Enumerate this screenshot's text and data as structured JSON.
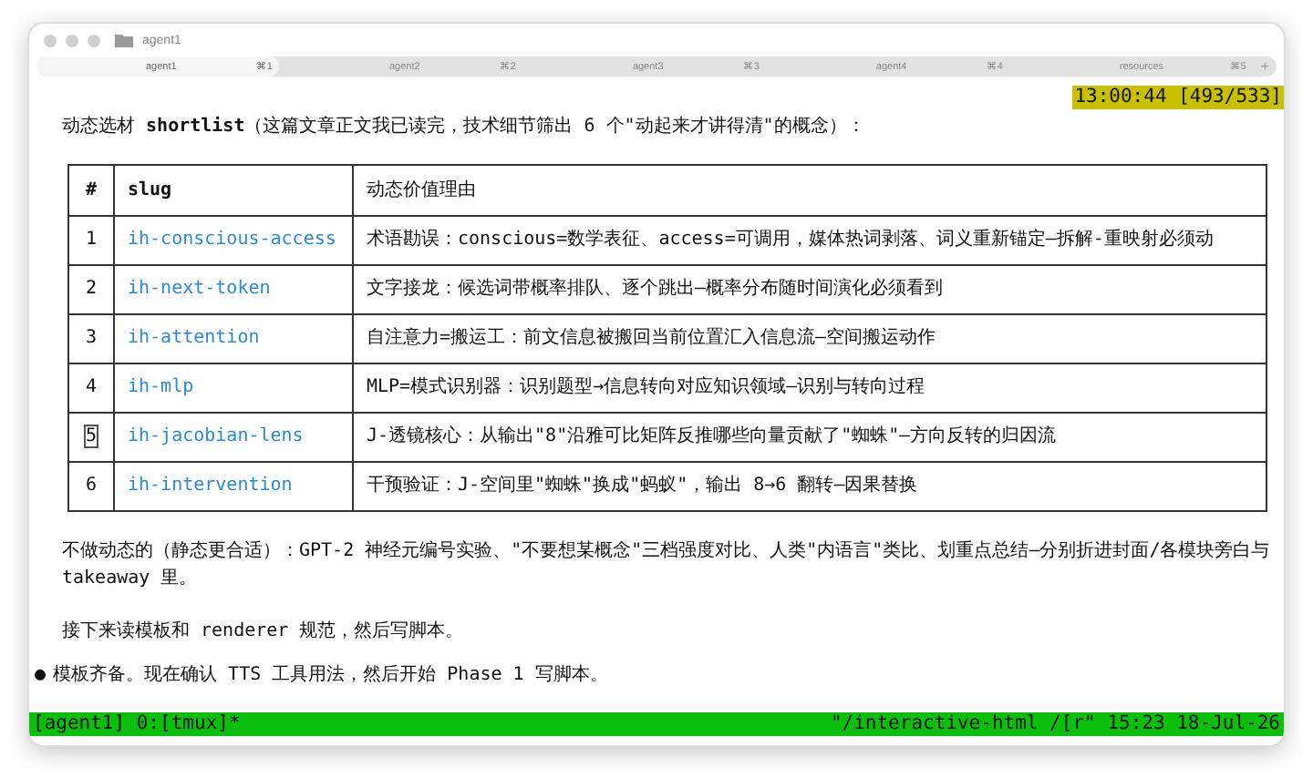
{
  "window": {
    "title": "agent1"
  },
  "tabs": [
    {
      "label": "agent1",
      "shortcut": "⌘1",
      "selected": true
    },
    {
      "label": "agent2",
      "shortcut": "⌘2",
      "selected": false
    },
    {
      "label": "agent3",
      "shortcut": "⌘3",
      "selected": false
    },
    {
      "label": "agent4",
      "shortcut": "⌘4",
      "selected": false
    },
    {
      "label": "resources",
      "shortcut": "⌘5",
      "selected": false
    }
  ],
  "new_tab": "+",
  "clock": "13:00:44 [493/533]",
  "intro": "动态选材 **shortlist**（这篇文章正文我已读完，技术细节筛出 6 个\"动起来才讲得清\"的概念）：",
  "table": {
    "columns": [
      "#",
      "slug",
      "动态价值理由"
    ],
    "rows": [
      {
        "num": "1",
        "slug": "ih-conscious-access",
        "reason": "术语勘误：conscious=数学表征、access=可调用，媒体热词剥落、词义重新锚定—拆解-重映射必须动",
        "cursor": false
      },
      {
        "num": "2",
        "slug": "ih-next-token",
        "reason": "文字接龙：候选词带概率排队、逐个跳出—概率分布随时间演化必须看到",
        "cursor": false
      },
      {
        "num": "3",
        "slug": "ih-attention",
        "reason": "自注意力=搬运工：前文信息被搬回当前位置汇入信息流—空间搬运动作",
        "cursor": false
      },
      {
        "num": "4",
        "slug": "ih-mlp",
        "reason": "MLP=模式识别器：识别题型→信息转向对应知识领域—识别与转向过程",
        "cursor": false
      },
      {
        "num": "5",
        "slug": "ih-jacobian-lens",
        "reason": "J-透镜核心：从输出\"8\"沿雅可比矩阵反推哪些向量贡献了\"蜘蛛\"—方向反转的归因流",
        "cursor": true
      },
      {
        "num": "6",
        "slug": "ih-intervention",
        "reason": "干预验证：J-空间里\"蜘蛛\"换成\"蚂蚁\"，输出 8→6 翻转—因果替换",
        "cursor": false
      }
    ]
  },
  "paragraphs": [
    "不做动态的（静态更合适）：GPT-2 神经元编号实验、\"不要想某概念\"三档强度对比、人类\"内语言\"类比、划重点总结—分别折进封面/各模块旁白与 takeaway 里。",
    "接下来读模板和 renderer 规范，然后写脚本。"
  ],
  "bullet": {
    "mark": "●",
    "text": "模板齐备。现在确认 TTS 工具用法，然后开始 Phase 1 写脚本。"
  },
  "status_bar": {
    "left": "[agent1] 0:[tmux]*",
    "right": "\"/interactive-html /[r\" 15:23 18-Jul-26"
  }
}
